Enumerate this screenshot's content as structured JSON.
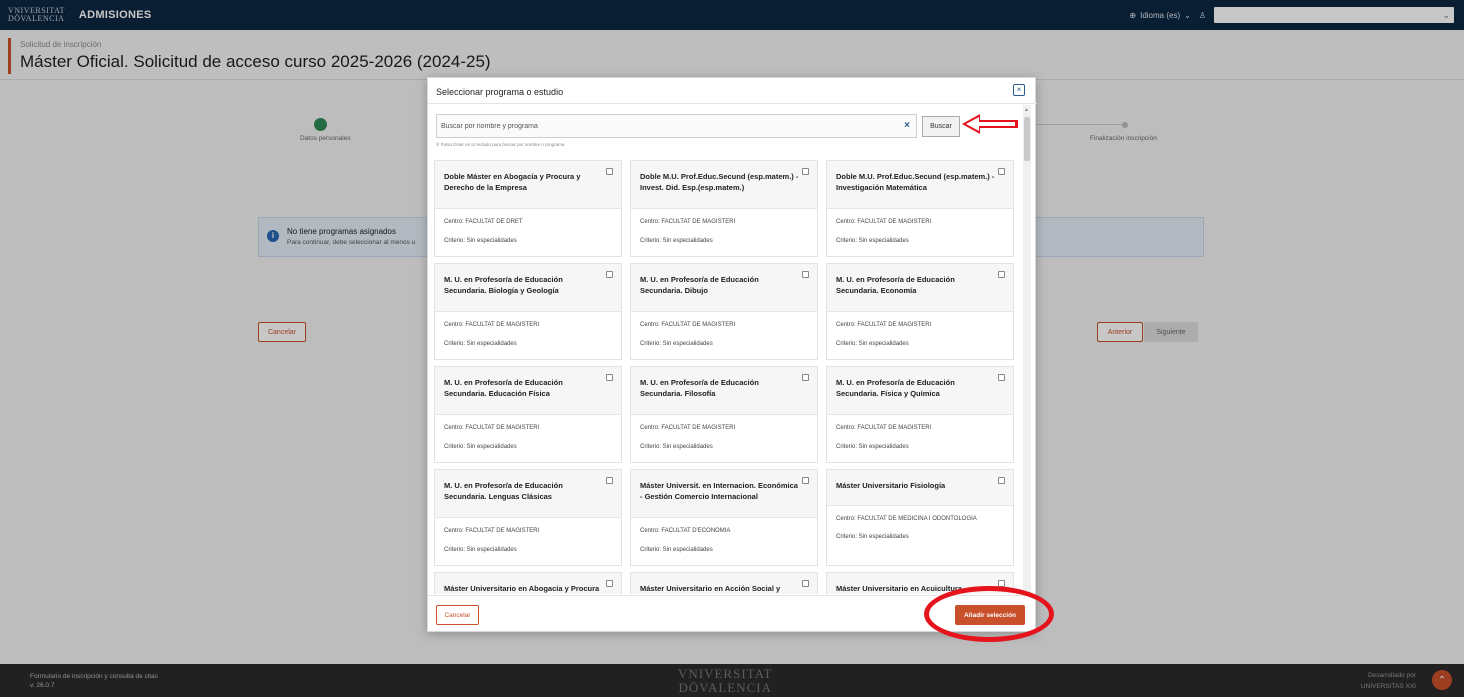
{
  "topbar": {
    "logo_line1": "VNIVERSITAT",
    "logo_line2": "DÖVALENCIA",
    "app_name": "ADMISIONES",
    "language": "Idioma (es)"
  },
  "header": {
    "breadcrumb": "Solicitud de inscripción",
    "title": "Máster Oficial. Solicitud de acceso curso 2025-2026 (2024-25)"
  },
  "stepper": {
    "step1_label": "Datos personales",
    "last_label": "Finalización inscripción"
  },
  "info_banner": {
    "title": "No tiene programas asignados",
    "subtitle": "Para continuar, debe seleccionar al menos u"
  },
  "background_buttons": {
    "cancel": "Cancelar",
    "previous": "Anterior",
    "next": "Siguiente"
  },
  "modal": {
    "title": "Seleccionar programa o estudio",
    "search_placeholder": "Buscar por nombre y programa",
    "search_button": "Buscar",
    "search_hint": "Pulsa Enter en tu teclado para buscar por nombre o programa",
    "cancel_button": "Cancelar",
    "add_button": "Añadir selección",
    "cards": [
      {
        "title": "Doble Máster en Abogacía y Procura y Derecho de la Empresa",
        "centro": "Centro: FACULTAT DE DRET",
        "criterio": "Criterio: Sin especialidades"
      },
      {
        "title": "Doble M.U. Prof.Educ.Secund (esp.matem.) - Invest. Did. Esp.(esp.matem.)",
        "centro": "Centro: FACULTAT DE MAGISTERI",
        "criterio": "Criterio: Sin especialidades"
      },
      {
        "title": "Doble M.U. Prof.Educ.Secund (esp.matem.) - Investigación Matemática",
        "centro": "Centro: FACULTAT DE MAGISTERI",
        "criterio": "Criterio: Sin especialidades"
      },
      {
        "title": "M. U. en Profesor/a de Educación Secundaria. Biología y Geología",
        "centro": "Centro: FACULTAT DE MAGISTERI",
        "criterio": "Criterio: Sin especialidades"
      },
      {
        "title": "M. U. en Profesor/a de Educación Secundaria. Dibujo",
        "centro": "Centro: FACULTAT DE MAGISTERI",
        "criterio": "Criterio: Sin especialidades"
      },
      {
        "title": "M. U. en Profesor/a de Educación Secundaria. Economía",
        "centro": "Centro: FACULTAT DE MAGISTERI",
        "criterio": "Criterio: Sin especialidades"
      },
      {
        "title": "M. U. en Profesor/a de Educación Secundaria. Educación Física",
        "centro": "Centro: FACULTAT DE MAGISTERI",
        "criterio": "Criterio: Sin especialidades"
      },
      {
        "title": "M. U. en Profesor/a de Educación Secundaria. Filosofía",
        "centro": "Centro: FACULTAT DE MAGISTERI",
        "criterio": "Criterio: Sin especialidades"
      },
      {
        "title": "M. U. en Profesor/a de Educación Secundaria. Física y Química",
        "centro": "Centro: FACULTAT DE MAGISTERI",
        "criterio": "Criterio: Sin especialidades"
      },
      {
        "title": "M. U. en Profesor/a de Educación Secundaria. Lenguas Clásicas",
        "centro": "Centro: FACULTAT DE MAGISTERI",
        "criterio": "Criterio: Sin especialidades"
      },
      {
        "title": "Máster Universit. en Internacion. Económica - Gestión Comercio Internacional",
        "centro": "Centro: FACULTAT D'ECONOMIA",
        "criterio": "Criterio: Sin especialidades"
      },
      {
        "title": "Máster Universitario Fisiología",
        "centro": "Centro: FACULTAT DE MEDICINA I ODONTOLOGIA",
        "criterio": "Criterio: Sin especialidades"
      },
      {
        "title": "Máster Universitario en Abogacía y Procura",
        "centro": "",
        "criterio": ""
      },
      {
        "title": "Máster Universitario en Acción Social y Educativa",
        "centro": "",
        "criterio": ""
      },
      {
        "title": "Máster Universitario en Acuicultura",
        "centro": "",
        "criterio": ""
      }
    ]
  },
  "footer": {
    "left_line1": "Formulario de inscripción y consulta de citas",
    "left_line2": "v. 26.0.7",
    "logo_line1": "VNIVERSITAT",
    "logo_line2": "DÖVALENCIA",
    "right_line1": "Desarrollado por",
    "right_line2": "UNIVERSITAS XXI"
  },
  "colors": {
    "topbar": "#0d2742",
    "accent": "#c8502a",
    "annotation": "#e5141c"
  }
}
